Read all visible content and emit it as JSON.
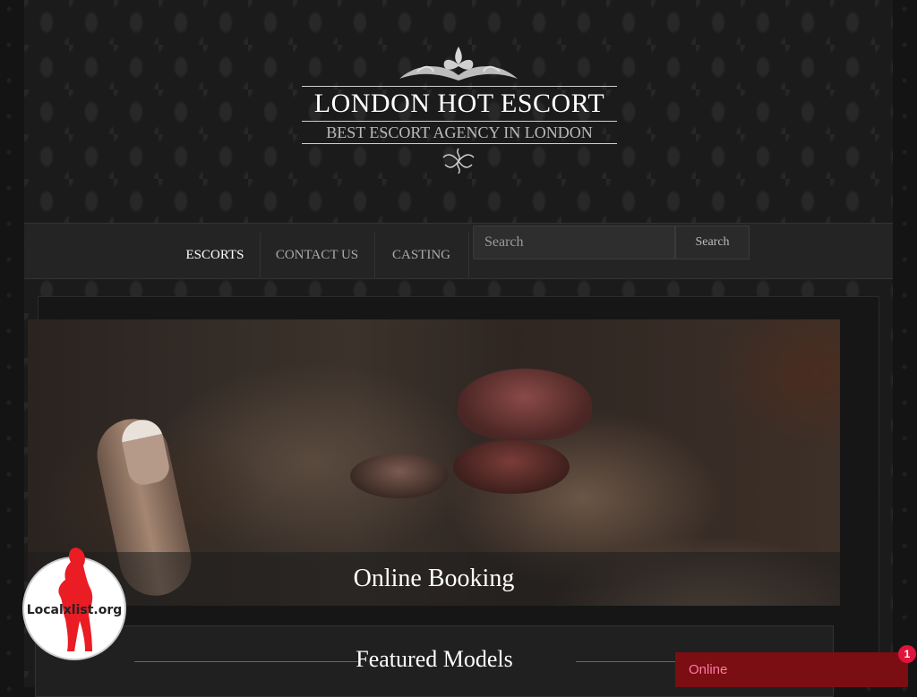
{
  "header": {
    "title": "LONDON HOT ESCORT",
    "subtitle": "BEST ESCORT AGENCY IN LONDON"
  },
  "nav": {
    "items": [
      {
        "label": "ESCORTS",
        "active": true
      },
      {
        "label": "CONTACT US",
        "active": false
      },
      {
        "label": "CASTING",
        "active": false
      }
    ]
  },
  "search": {
    "placeholder": "Search",
    "button_label": "Search"
  },
  "hero": {
    "caption": "Online Booking"
  },
  "featured": {
    "title": "Featured Models"
  },
  "badge": {
    "text": "Localxlist.org"
  },
  "chat": {
    "status": "Online",
    "count": "1"
  }
}
